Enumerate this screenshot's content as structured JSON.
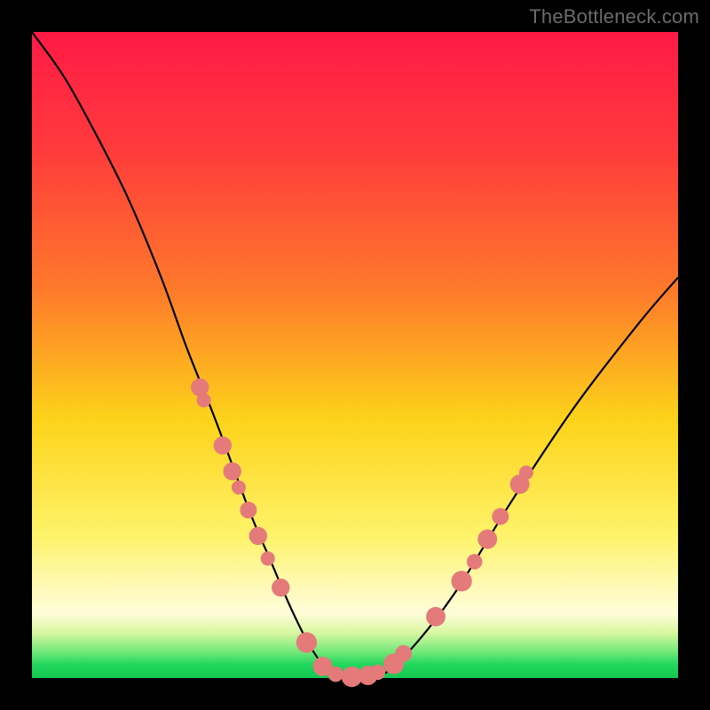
{
  "attribution": "TheBottleneck.com",
  "colors": {
    "frame": "#000000",
    "gradient_top": "#ff1a46",
    "gradient_mid": "#fdd31a",
    "gradient_bottom": "#16c951",
    "curve": "#000000",
    "dots": "#e47a7a"
  },
  "chart_data": {
    "type": "line",
    "title": "",
    "xlabel": "",
    "ylabel": "",
    "xlim": [
      0,
      100
    ],
    "ylim": [
      0,
      100
    ],
    "series": [
      {
        "name": "bottleneck-curve",
        "x": [
          0,
          5,
          10,
          15,
          20,
          24,
          28,
          31,
          34,
          37,
          40,
          43,
          46,
          49,
          52,
          55,
          60,
          66,
          74,
          84,
          94,
          100
        ],
        "y": [
          100,
          93,
          84,
          74,
          62,
          51,
          41,
          33,
          25,
          18,
          11,
          5,
          1,
          0,
          0,
          1,
          6,
          14,
          27,
          42,
          55,
          62
        ]
      }
    ],
    "markers": [
      {
        "x": 26.0,
        "y": 45.0,
        "r": 1.4
      },
      {
        "x": 26.6,
        "y": 43.0,
        "r": 1.1
      },
      {
        "x": 29.5,
        "y": 36.0,
        "r": 1.4
      },
      {
        "x": 31.0,
        "y": 32.0,
        "r": 1.4
      },
      {
        "x": 32.0,
        "y": 29.5,
        "r": 1.1
      },
      {
        "x": 33.5,
        "y": 26.0,
        "r": 1.3
      },
      {
        "x": 35.0,
        "y": 22.0,
        "r": 1.4
      },
      {
        "x": 36.5,
        "y": 18.5,
        "r": 1.1
      },
      {
        "x": 38.5,
        "y": 14.0,
        "r": 1.4
      },
      {
        "x": 42.5,
        "y": 5.5,
        "r": 1.6
      },
      {
        "x": 45.0,
        "y": 1.8,
        "r": 1.5
      },
      {
        "x": 47.0,
        "y": 0.6,
        "r": 1.2
      },
      {
        "x": 49.5,
        "y": 0.2,
        "r": 1.6
      },
      {
        "x": 52.0,
        "y": 0.4,
        "r": 1.5
      },
      {
        "x": 53.5,
        "y": 0.9,
        "r": 1.2
      },
      {
        "x": 56.0,
        "y": 2.2,
        "r": 1.6
      },
      {
        "x": 57.5,
        "y": 3.8,
        "r": 1.3
      },
      {
        "x": 62.5,
        "y": 9.5,
        "r": 1.5
      },
      {
        "x": 66.5,
        "y": 15.0,
        "r": 1.6
      },
      {
        "x": 68.5,
        "y": 18.0,
        "r": 1.2
      },
      {
        "x": 70.5,
        "y": 21.5,
        "r": 1.5
      },
      {
        "x": 72.5,
        "y": 25.0,
        "r": 1.3
      },
      {
        "x": 75.5,
        "y": 30.0,
        "r": 1.5
      },
      {
        "x": 76.5,
        "y": 31.8,
        "r": 1.1
      }
    ]
  }
}
